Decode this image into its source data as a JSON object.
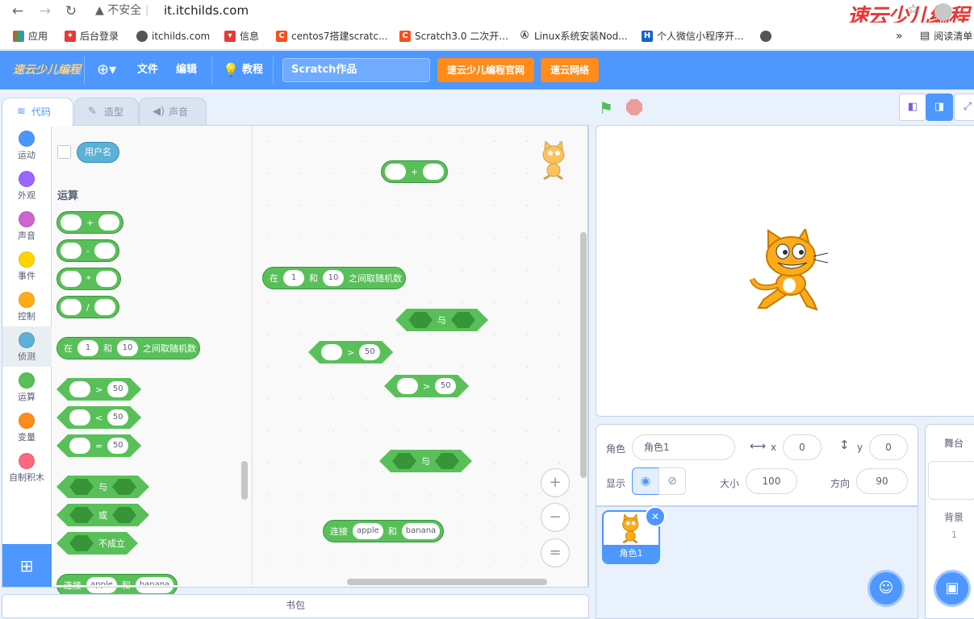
{
  "browser": {
    "security": "不安全",
    "url": "it.itchilds.com",
    "bookmarks": [
      "应用",
      "后台登录",
      "itchilds.com",
      "信息",
      "centos7搭建scratc...",
      "Scratch3.0 二次开...",
      "Linux系统安装Nod...",
      "个人微信小程序开..."
    ],
    "more": "»",
    "reading_list": "阅读清单",
    "watermark": "速云少儿编程"
  },
  "menu": {
    "logo": "速云少儿编程",
    "file": "文件",
    "edit": "编辑",
    "tutorial": "教程",
    "project_title": "Scratch作品",
    "btn_official": "速云少儿编程官网",
    "btn_network": "速云网络"
  },
  "tabs": {
    "code": "代码",
    "costume": "造型",
    "sound": "声音"
  },
  "categories": [
    {
      "label": "运动",
      "color": "#4c97ff"
    },
    {
      "label": "外观",
      "color": "#9966ff"
    },
    {
      "label": "声音",
      "color": "#cf63cf"
    },
    {
      "label": "事件",
      "color": "#ffd500"
    },
    {
      "label": "控制",
      "color": "#ffab19"
    },
    {
      "label": "侦测",
      "color": "#5cb1d6"
    },
    {
      "label": "运算",
      "color": "#59c059"
    },
    {
      "label": "变量",
      "color": "#ff8c1a"
    },
    {
      "label": "自制积木",
      "color": "#ff6680"
    }
  ],
  "palette": {
    "username": "用户名",
    "section": "运算",
    "ops": [
      "+",
      "-",
      "*",
      "/"
    ],
    "random": {
      "pre": "在",
      "a": "1",
      "mid": "和",
      "b": "10",
      "post": "之间取随机数"
    },
    "compare": [
      {
        "op": ">",
        "v": "50"
      },
      {
        "op": "<",
        "v": "50"
      },
      {
        "op": "=",
        "v": "50"
      }
    ],
    "and": "与",
    "or": "或",
    "not": "不成立",
    "join": {
      "pre": "连接",
      "a": "apple",
      "mid": "和",
      "b": "banana"
    }
  },
  "workspace": {
    "plus": "+",
    "random": {
      "pre": "在",
      "a": "1",
      "mid": "和",
      "b": "10",
      "post": "之间取随机数"
    },
    "and1": "与",
    "gt1": {
      "op": ">",
      "v": "50"
    },
    "gt2": {
      "op": ">",
      "v": "50"
    },
    "and2": "与",
    "join": {
      "pre": "连接",
      "a": "apple",
      "mid": "和",
      "b": "banana"
    }
  },
  "zoom": {
    "in": "+",
    "out": "−",
    "reset": "="
  },
  "backpack": "书包",
  "sprite": {
    "label_sprite": "角色",
    "name": "角色1",
    "x_label": "x",
    "x": "0",
    "y_label": "y",
    "y": "0",
    "label_show": "显示",
    "label_size": "大小",
    "size": "100",
    "label_direction": "方向",
    "direction": "90",
    "thumb_name": "角色1"
  },
  "stage_panel": {
    "title": "舞台",
    "backdrop_label": "背景",
    "backdrop_count": "1"
  }
}
